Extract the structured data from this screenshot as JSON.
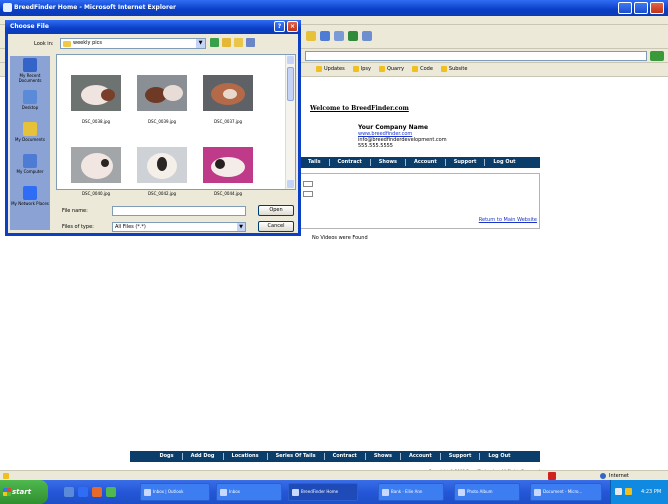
{
  "browser": {
    "title": "BreedFinder Home - Microsoft Internet Explorer",
    "links": [
      "Updates",
      "Ipsy",
      "Quarry",
      "Code",
      "Subsite"
    ],
    "status_zone": "Internet"
  },
  "page": {
    "welcome": "Welcome to BreedFinder.com",
    "company_name": "Your Company Name",
    "company_link": "www.breedfinder.com",
    "company_email": "info@breedfinderdevelopment.com",
    "company_phone": "555.555.5555",
    "nav_top": [
      "Tails",
      "Contract",
      "Shows",
      "Account",
      "Support",
      "Log Out"
    ],
    "nav_bottom": [
      "Dogs",
      "Add Dog",
      "Locations",
      "Series Of Tails",
      "Contract",
      "Shows",
      "Account",
      "Support",
      "Log Out"
    ],
    "return_link": "Return to Main Website",
    "no_videos": "No Videos were Found",
    "copyright": "Copyright © 2008 BreedFinder, Inc. All Rights Reserved"
  },
  "dialog": {
    "title": "Choose File",
    "look_in_label": "Look in:",
    "look_in_value": "weekly pics",
    "places": [
      "My Recent Documents",
      "Desktop",
      "My Documents",
      "My Computer",
      "My Network Places"
    ],
    "files": [
      {
        "name": "DSC_0038.jpg"
      },
      {
        "name": "DSC_0039.jpg"
      },
      {
        "name": "DSC_0037.jpg"
      },
      {
        "name": "DSC_0040.jpg"
      },
      {
        "name": "DSC_0042.jpg"
      },
      {
        "name": "DSC_0044.jpg"
      }
    ],
    "file_name_label": "File name:",
    "file_name_value": "",
    "files_of_type_label": "Files of type:",
    "files_of_type_value": "All Files (*.*)",
    "open_label": "Open",
    "cancel_label": "Cancel"
  },
  "taskbar": {
    "start_label": "start",
    "tasks": [
      "Inbox | Outlook",
      "Inbox",
      "BreedFinder Home",
      "Bank - Ellie Ann",
      "Photo Album",
      "Document - Micro..."
    ],
    "clock": "4:23 PM"
  },
  "colors": {
    "xp_blue": "#0a3fc6",
    "nav_blue": "#0a3d69",
    "link_blue": "#1a33c8",
    "xp_green": "#3a9a3a"
  }
}
